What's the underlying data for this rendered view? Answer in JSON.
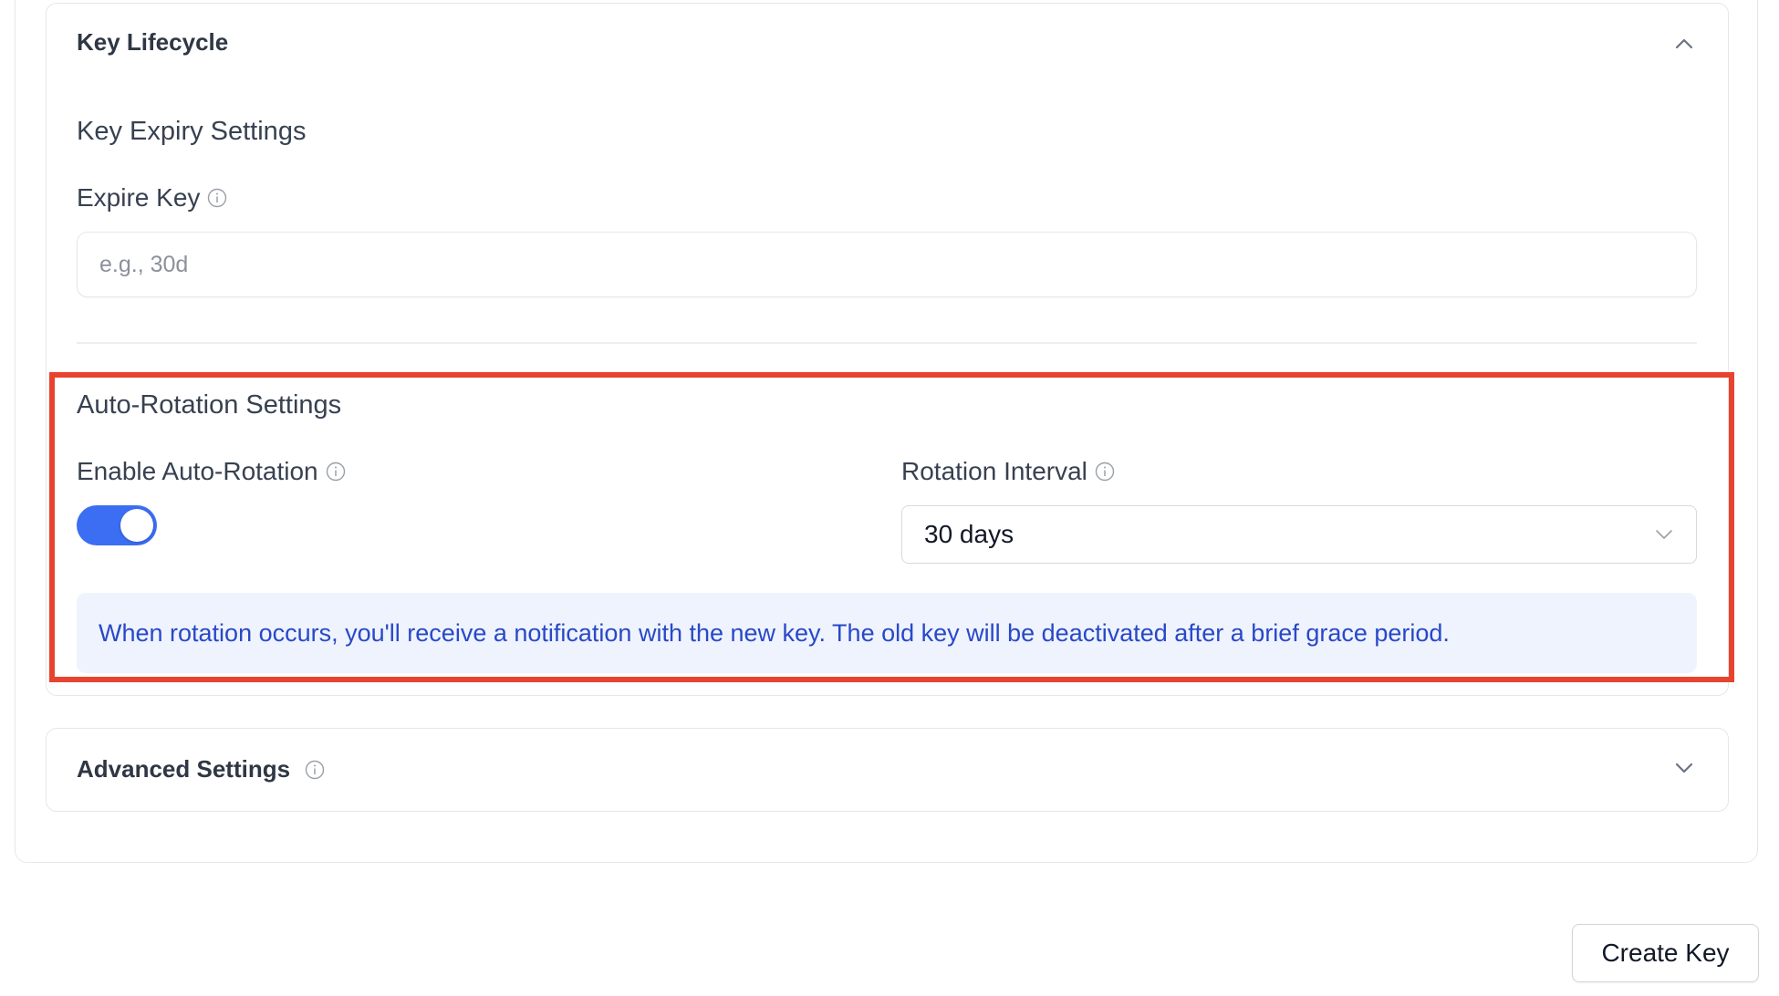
{
  "lifecycle": {
    "title": "Key Lifecycle",
    "collapse_icon": "chevron-up-icon"
  },
  "expiry": {
    "heading": "Key Expiry Settings",
    "expire_label": "Expire Key",
    "expire_value": "",
    "expire_placeholder": "e.g., 30d"
  },
  "rotation": {
    "heading": "Auto-Rotation Settings",
    "enable_label": "Enable Auto-Rotation",
    "enabled": true,
    "interval_label": "Rotation Interval",
    "interval_value": "30 days",
    "notice": "When rotation occurs, you'll receive a notification with the new key. The old key will be deactivated after a brief grace period."
  },
  "advanced": {
    "title": "Advanced Settings",
    "expand_icon": "chevron-down-icon"
  },
  "actions": {
    "create_label": "Create Key"
  },
  "colors": {
    "accent": "#3b6ef3",
    "highlight": "#e8432f",
    "notice_bg": "#eef3fd",
    "notice_text": "#2948c8"
  }
}
